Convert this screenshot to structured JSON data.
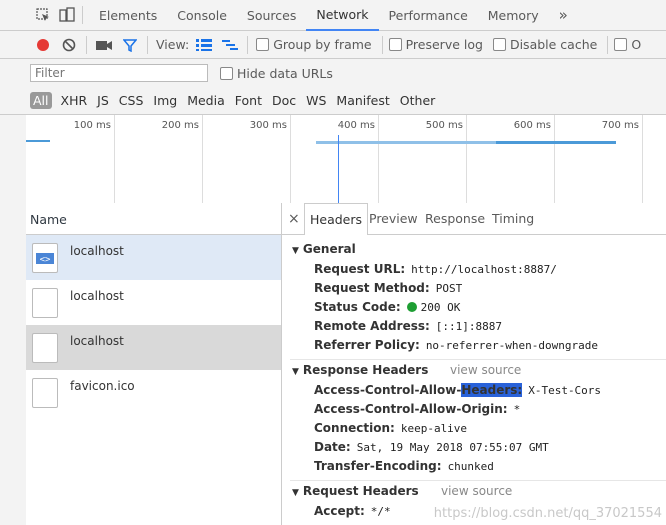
{
  "tabs": [
    "Elements",
    "Console",
    "Sources",
    "Network",
    "Performance",
    "Memory"
  ],
  "active_tab": "Network",
  "more_tabs": "»",
  "toolbar": {
    "view_label": "View:",
    "group_by_frame": "Group by frame",
    "preserve_log": "Preserve log",
    "disable_cache": "Disable cache",
    "offline_cut": "O"
  },
  "filter": {
    "placeholder": "Filter",
    "hide_data_urls": "Hide data URLs"
  },
  "types": [
    "All",
    "XHR",
    "JS",
    "CSS",
    "Img",
    "Media",
    "Font",
    "Doc",
    "WS",
    "Manifest",
    "Other"
  ],
  "timeline": {
    "ticks": [
      "100 ms",
      "200 ms",
      "300 ms",
      "400 ms",
      "500 ms",
      "600 ms",
      "700 ms"
    ]
  },
  "list": {
    "header": "Name",
    "items": [
      "localhost",
      "localhost",
      "localhost",
      "favicon.ico"
    ]
  },
  "detail_tabs": [
    "Headers",
    "Preview",
    "Response",
    "Timing"
  ],
  "close_glyph": "×",
  "general": {
    "title": "General",
    "rows": [
      {
        "key": "Request URL:",
        "value": "http://localhost:8887/"
      },
      {
        "key": "Request Method:",
        "value": "POST"
      },
      {
        "key": "Status Code:",
        "value": "200 OK"
      },
      {
        "key": "Remote Address:",
        "value": "[::1]:8887"
      },
      {
        "key": "Referrer Policy:",
        "value": "no-referrer-when-downgrade"
      }
    ]
  },
  "response_headers": {
    "title": "Response Headers",
    "view_source": "view source",
    "rows": [
      {
        "key_a": "Access-Control-Allow-",
        "key_b": "Headers:",
        "value": "X-Test-Cors"
      },
      {
        "key": "Access-Control-Allow-Origin:",
        "value": "*"
      },
      {
        "key": "Connection:",
        "value": "keep-alive"
      },
      {
        "key": "Date:",
        "value": "Sat, 19 May 2018 07:55:07 GMT"
      },
      {
        "key": "Transfer-Encoding:",
        "value": "chunked"
      }
    ]
  },
  "request_headers": {
    "title": "Request Headers",
    "view_source": "view source",
    "rows": [
      {
        "key": "Accept:",
        "value": "*/*"
      }
    ]
  },
  "watermark": "https://blog.csdn.net/qq_37021554",
  "colors": {
    "record": "#e53935",
    "status_ok": "#1e9e33",
    "accent": "#4285f4",
    "selection": "#2962d9"
  }
}
